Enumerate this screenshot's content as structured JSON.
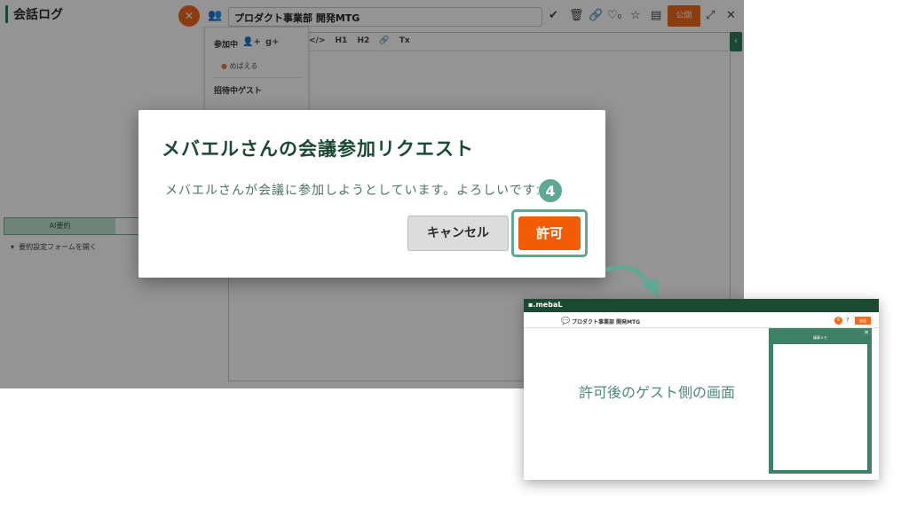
{
  "app": {
    "log_title": "会話ログ",
    "meeting_title": "プロダクト事業部 開発MTG",
    "publish_label": "公開",
    "like_count": "0",
    "participants": {
      "joined_label": "参加中",
      "add_user_glyph": "+",
      "google_label": "g+",
      "member_name": "めばえる",
      "invite_label": "招待中ゲスト"
    },
    "editor_toolbar": [
      "</>",
      "H1",
      "H2",
      "🔗",
      "Tx"
    ],
    "ai_tabs": [
      "AI要約",
      ""
    ],
    "ai_open_label": "要約設定フォームを開く"
  },
  "dialog": {
    "title": "メバエルさんの会議参加リクエスト",
    "body": "メバエルさんが会議に参加しようとしています。よろしいですか？",
    "step_number": "4",
    "cancel_label": "キャンセル",
    "allow_label": "許可"
  },
  "preview": {
    "logo": "▪.mebaL",
    "meeting_title": "プロダクト事業部 開発MTG",
    "badge": "6",
    "exit_label": "退室",
    "caption": "許可後のゲスト側の画面",
    "memo_title": "議事メモ"
  },
  "colors": {
    "brand_green": "#1b4a33",
    "accent_orange": "#f25c05",
    "step_teal": "#5fa894"
  }
}
